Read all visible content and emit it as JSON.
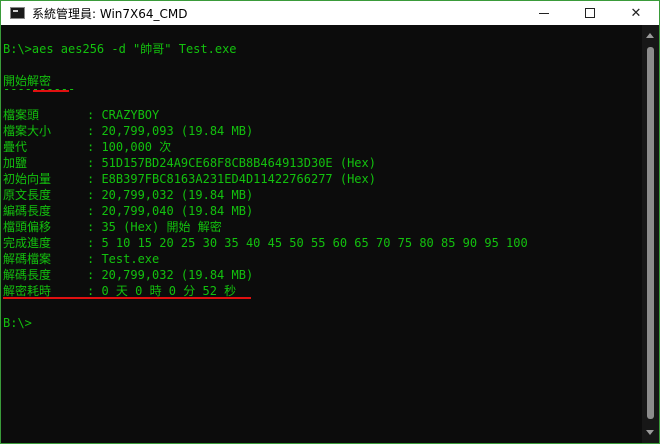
{
  "window": {
    "title": "系統管理員: Win7X64_CMD",
    "app_icon": "cmd-console-icon",
    "minimize_glyph": "",
    "close_glyph": "✕"
  },
  "console": {
    "command_line": "B:\\>aes aes256 -d \"帥哥\" Test.exe",
    "heading": "開始解密",
    "separator": "----------",
    "rows": [
      {
        "label": "檔案頭",
        "value": ": CRAZYBOY"
      },
      {
        "label": "檔案大小",
        "value": ": 20,799,093 (19.84 MB)"
      },
      {
        "label": "疊代",
        "value": ": 100,000 次"
      },
      {
        "label": "加鹽",
        "value": ": 51D157BD24A9CE68F8CB8B464913D30E (Hex)"
      },
      {
        "label": "初始向量",
        "value": ": E8B397FBC8163A231ED4D11422766277 (Hex)"
      },
      {
        "label": "原文長度",
        "value": ": 20,799,032 (19.84 MB)"
      },
      {
        "label": "編碼長度",
        "value": ": 20,799,040 (19.84 MB)"
      },
      {
        "label": "檔頭偏移",
        "value": ": 35 (Hex) 開始 解密"
      },
      {
        "label": "完成進度",
        "value": ": 5 10 15 20 25 30 35 40 45 50 55 60 65 70 75 80 85 90 95 100"
      },
      {
        "label": "解碼檔案",
        "value": ": Test.exe"
      },
      {
        "label": "解碼長度",
        "value": ": 20,799,032 (19.84 MB)"
      },
      {
        "label": "解密耗時",
        "value": ": 0 天 0 時 0 分 52 秒"
      }
    ],
    "prompt": "B:\\>",
    "text_color": "#13c10e",
    "background_color": "#0c0c0c",
    "annotation_color": "#e01010"
  }
}
